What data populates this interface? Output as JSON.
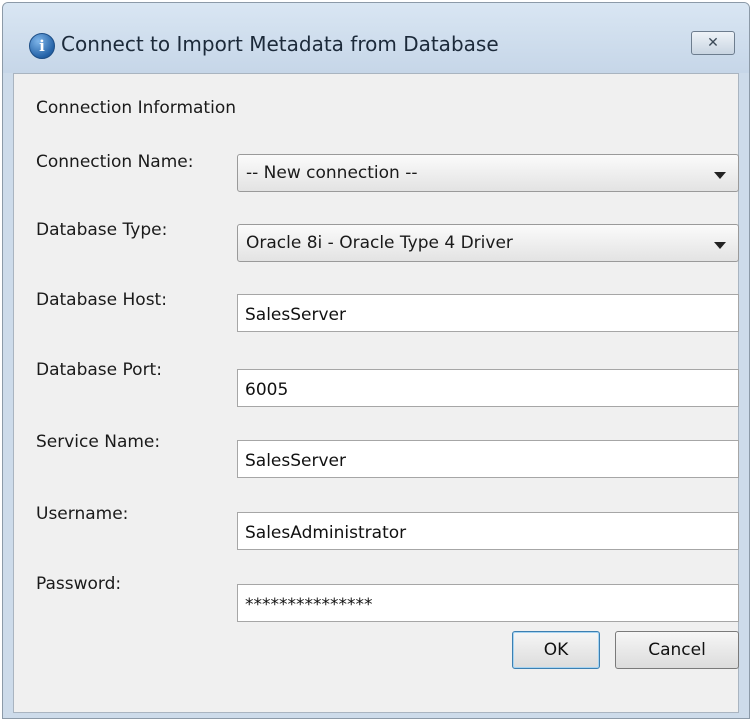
{
  "window": {
    "title": "Connect to Import Metadata from Database",
    "title_icon": "info-icon",
    "close_glyph": "✕"
  },
  "form": {
    "section_label": "Connection Information",
    "connection_name": {
      "label": "Connection Name:",
      "value": "-- New connection --"
    },
    "database_type": {
      "label": "Database Type:",
      "value": "Oracle 8i - Oracle Type 4 Driver"
    },
    "database_host": {
      "label": "Database Host:",
      "value": "SalesServer"
    },
    "database_port": {
      "label": "Database Port:",
      "value": "6005"
    },
    "service_name": {
      "label": "Service Name:",
      "value": "SalesServer"
    },
    "username": {
      "label": "Username:",
      "value": "SalesAdministrator"
    },
    "password": {
      "label": "Password:",
      "value": "***************"
    }
  },
  "buttons": {
    "ok": "OK",
    "cancel": "Cancel"
  }
}
